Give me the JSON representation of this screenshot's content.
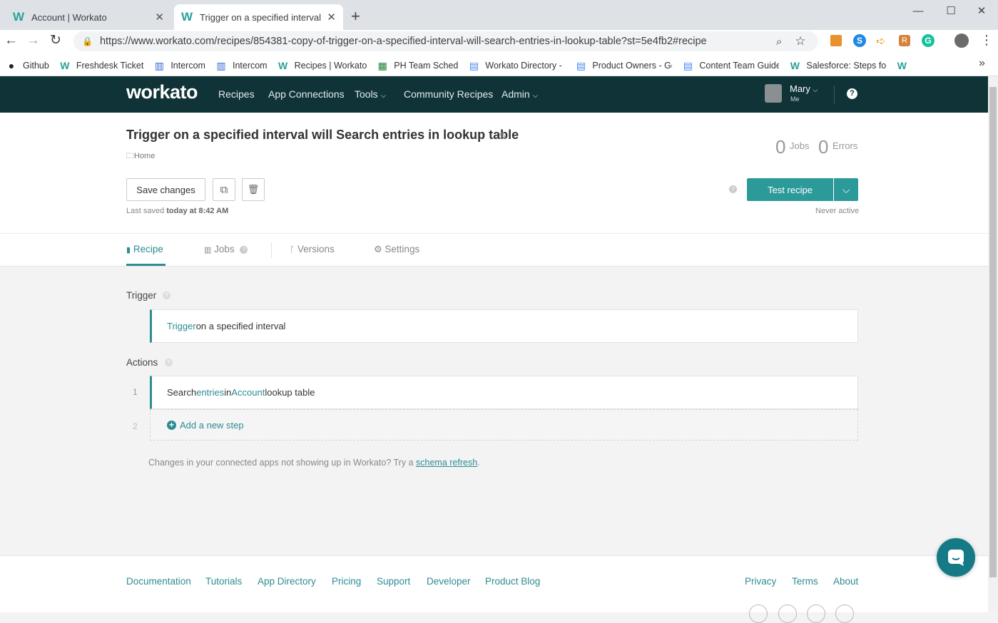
{
  "browser": {
    "tabs": [
      {
        "title": "Account | Workato"
      },
      {
        "title": "Trigger on a specified interval wil"
      }
    ],
    "url": "https://www.workato.com/recipes/854381-copy-of-trigger-on-a-specified-interval-will-search-entries-in-lookup-table?st=5e4fb2#recipe",
    "bookmarks": [
      "Github",
      "Freshdesk Ticket",
      "Intercom",
      "Intercom",
      "Recipes | Workato",
      "PH Team Sched",
      "Workato Directory - (",
      "Product Owners - Go",
      "Content Team Guidel",
      "Salesforce: Steps for ("
    ],
    "more": "»"
  },
  "nav": {
    "logo": "workato",
    "items": [
      "Recipes",
      "App Connections",
      "Tools",
      "Community Recipes",
      "Admin"
    ],
    "user_name": "Mary",
    "user_sub": "Me",
    "help": "?"
  },
  "recipe": {
    "title": "Trigger on a specified interval will Search entries in lookup table",
    "folder": "Home",
    "jobs_count": "0",
    "jobs_label": "Jobs",
    "errors_count": "0",
    "errors_label": "Errors",
    "save_label": "Save changes",
    "last_saved_prefix": "Last saved ",
    "last_saved_time": "today at 8:42 AM",
    "test_label": "Test recipe",
    "status": "Never active"
  },
  "tabs": [
    "Recipe",
    "Jobs",
    "Versions",
    "Settings"
  ],
  "trigger": {
    "heading": "Trigger",
    "link": "Trigger",
    "text": " on a specified interval"
  },
  "actions": {
    "heading": "Actions",
    "step_number": "1",
    "s1": "Search ",
    "s2": "entries",
    "s3": " in ",
    "s4": "Account",
    "s5": " lookup table",
    "add_number": "2",
    "add_label": "Add a new step"
  },
  "schema": {
    "text": "Changes in your connected apps not showing up in Workato? Try a ",
    "link": "schema refresh",
    "end": "."
  },
  "footer": {
    "left": [
      "Documentation",
      "Tutorials",
      "App Directory",
      "Pricing",
      "Support",
      "Developer",
      "Product Blog"
    ],
    "right": [
      "Privacy",
      "Terms",
      "About"
    ]
  },
  "colors": {
    "nav": "#0f3337",
    "accent": "#2d8c94",
    "button": "#2d9a9a"
  }
}
